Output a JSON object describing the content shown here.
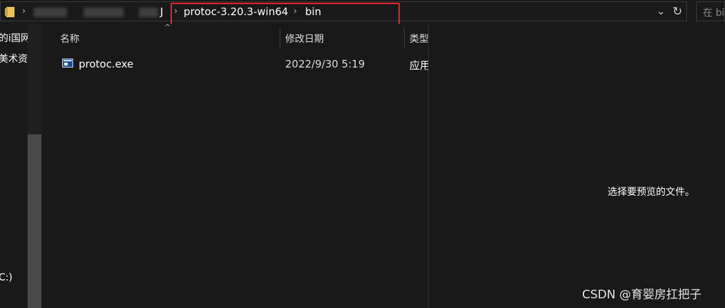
{
  "address": {
    "crumbs": [
      "protoc-3.20.3-win64",
      "bin"
    ],
    "partial_crumb": "J",
    "search_placeholder": "在 bin"
  },
  "nav": {
    "items": [
      "的i国网",
      "美术资",
      "C:)"
    ]
  },
  "file_list": {
    "columns": [
      "名称",
      "修改日期",
      "类型"
    ],
    "rows": [
      {
        "name": "protoc.exe",
        "modified": "2022/9/30 5:19",
        "type": "应用"
      }
    ]
  },
  "preview": {
    "message": "选择要预览的文件。"
  },
  "watermark": "CSDN @育婴房扛把子",
  "colors": {
    "background": "#191919",
    "highlight_border": "#e4262a",
    "folder": "#e8c35a"
  }
}
